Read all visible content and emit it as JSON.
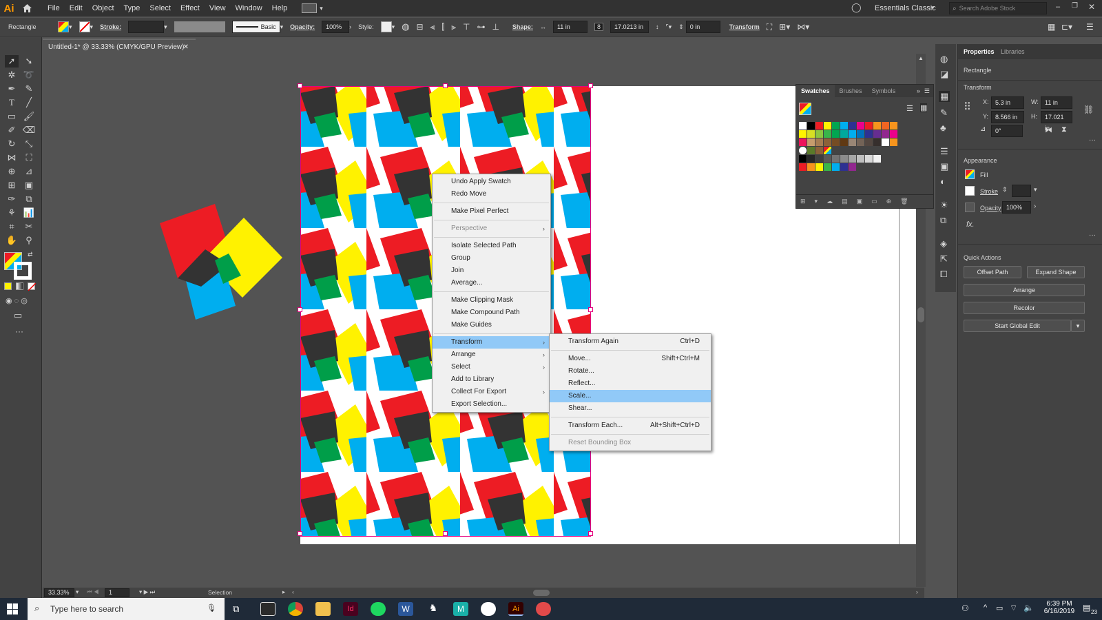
{
  "app": {
    "logo": "Ai"
  },
  "menubar": {
    "items": [
      "File",
      "Edit",
      "Object",
      "Type",
      "Select",
      "Effect",
      "View",
      "Window",
      "Help"
    ],
    "workspace": "Essentials Classic",
    "stock_search_placeholder": "Search Adobe Stock"
  },
  "control_bar": {
    "selection_type": "Rectangle",
    "stroke_label": "Stroke:",
    "brush_label": "Basic",
    "opacity_label": "Opacity:",
    "opacity_value": "100%",
    "style_label": "Style:",
    "shape_label": "Shape:",
    "width_value": "11 in",
    "height_value": "17.0213 in",
    "corner_value": "0 in",
    "transform_label": "Transform"
  },
  "document": {
    "tab_title": "Untitled-1* @ 33.33% (CMYK/GPU Preview)",
    "zoom": "33.33%",
    "artboard_number": "1",
    "status_tool": "Selection"
  },
  "context_menu": {
    "items": [
      {
        "label": "Undo Apply Swatch"
      },
      {
        "label": "Redo Move"
      },
      {
        "sep": true
      },
      {
        "label": "Make Pixel Perfect"
      },
      {
        "sep": true
      },
      {
        "label": "Perspective",
        "submenu": true,
        "disabled": true
      },
      {
        "sep": true
      },
      {
        "label": "Isolate Selected Path"
      },
      {
        "label": "Group"
      },
      {
        "label": "Join"
      },
      {
        "label": "Average..."
      },
      {
        "sep": true
      },
      {
        "label": "Make Clipping Mask"
      },
      {
        "label": "Make Compound Path"
      },
      {
        "label": "Make Guides"
      },
      {
        "sep": true
      },
      {
        "label": "Transform",
        "submenu": true,
        "highlighted": true
      },
      {
        "label": "Arrange",
        "submenu": true
      },
      {
        "label": "Select",
        "submenu": true
      },
      {
        "label": "Add to Library"
      },
      {
        "label": "Collect For Export",
        "submenu": true
      },
      {
        "label": "Export Selection..."
      }
    ]
  },
  "transform_submenu": {
    "items": [
      {
        "label": "Transform Again",
        "shortcut": "Ctrl+D"
      },
      {
        "sep": true
      },
      {
        "label": "Move...",
        "shortcut": "Shift+Ctrl+M"
      },
      {
        "label": "Rotate..."
      },
      {
        "label": "Reflect..."
      },
      {
        "label": "Scale...",
        "highlighted": true
      },
      {
        "label": "Shear..."
      },
      {
        "sep": true
      },
      {
        "label": "Transform Each...",
        "shortcut": "Alt+Shift+Ctrl+D"
      },
      {
        "sep": true
      },
      {
        "label": "Reset Bounding Box",
        "disabled": true
      }
    ]
  },
  "swatches_panel": {
    "tabs": [
      "Swatches",
      "Brushes",
      "Symbols"
    ],
    "row1": [
      "#ffffff",
      "#000000",
      "#ed1c24",
      "#fff200",
      "#00a651",
      "#00aeef",
      "#2e3192",
      "#ec008c",
      "#ed1c24",
      "#f7941d",
      "#f26522",
      "#f7941d"
    ],
    "row2": [
      "#fff200",
      "#d7df23",
      "#8dc63f",
      "#39b54a",
      "#00a651",
      "#00a99d",
      "#00aeef",
      "#0072bc",
      "#2e3192",
      "#662d91",
      "#92278f",
      "#ec008c"
    ],
    "row3": [
      "#ed145b",
      "#c69c6d",
      "#a67c52",
      "#8c6239",
      "#754c24",
      "#603913",
      "#998675",
      "#736357",
      "#534741",
      "#362f2d",
      "#ffffff",
      "#f7941d"
    ],
    "grays": [
      "#000000",
      "#262626",
      "#404040",
      "#595959",
      "#737373",
      "#8c8c8c",
      "#a6a6a6",
      "#bfbfbf",
      "#d9d9d9",
      "#f2f2f2"
    ],
    "group": [
      "#ed1c24",
      "#f7941d",
      "#fff200",
      "#39b54a",
      "#00aeef",
      "#2e3192",
      "#92278f"
    ]
  },
  "properties_panel": {
    "tabs": [
      "Properties",
      "Libraries"
    ],
    "object_type": "Rectangle",
    "transform_title": "Transform",
    "x_label": "X:",
    "x_value": "5.3 in",
    "y_label": "Y:",
    "y_value": "8.566 in",
    "w_label": "W:",
    "w_value": "11 in",
    "h_label": "H:",
    "h_value": "17.021 in",
    "rotation_value": "0°",
    "appearance_title": "Appearance",
    "fill_label": "Fill",
    "stroke_label": "Stroke",
    "opacity_label": "Opacity",
    "opacity_value": "100%",
    "fx_label": "fx.",
    "quick_actions_title": "Quick Actions",
    "offset_path": "Offset Path",
    "expand_shape": "Expand Shape",
    "arrange": "Arrange",
    "recolor": "Recolor",
    "start_global_edit": "Start Global Edit"
  },
  "taskbar": {
    "search_placeholder": "Type here to search",
    "time": "6:39 PM",
    "date": "6/16/2019",
    "notifications": "23"
  },
  "colors": {
    "pattern_red": "#ed1c24",
    "pattern_yellow": "#fff200",
    "pattern_blue": "#00aeef",
    "pattern_green": "#009e49",
    "pattern_dark": "#333333",
    "selection": "#e6007e",
    "menu_highlight": "#91c9f7",
    "ai_orange": "#ff9a00"
  }
}
